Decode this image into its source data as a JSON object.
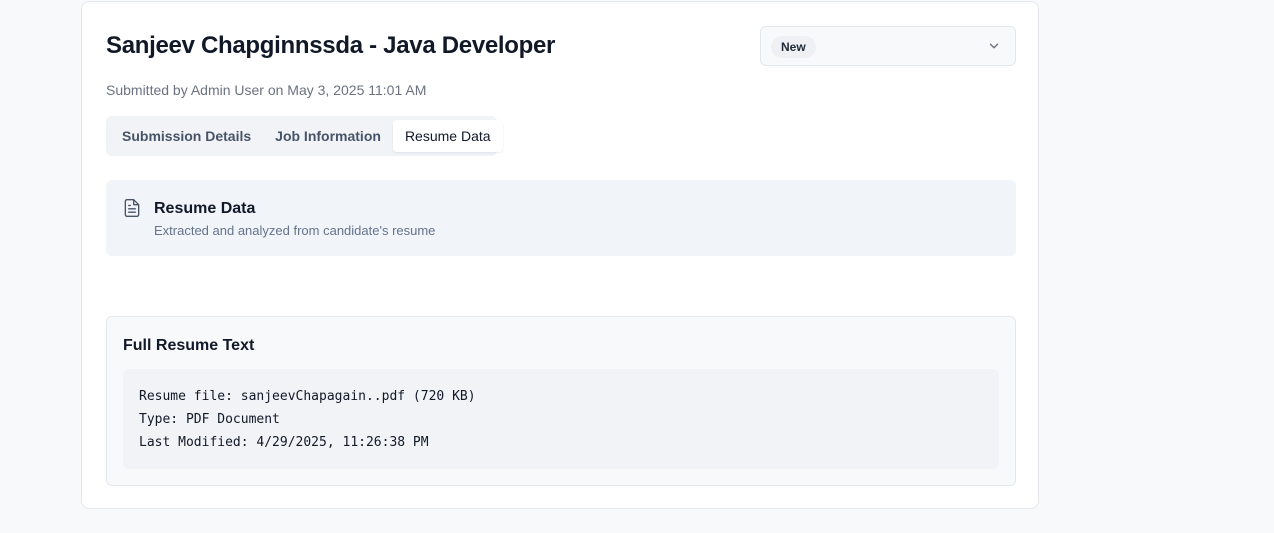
{
  "header": {
    "title": "Sanjeev Chapginnssda - Java Developer",
    "subtitle": "Submitted by Admin User on May 3, 2025 11:01 AM"
  },
  "status_select": {
    "value": "New",
    "icon": "chevron-down-icon"
  },
  "tabs": [
    {
      "label": "Submission Details",
      "active": false
    },
    {
      "label": "Job Information",
      "active": false
    },
    {
      "label": "Resume Data",
      "active": true
    }
  ],
  "info_box": {
    "icon": "document-icon",
    "title": "Resume Data",
    "description": "Extracted and analyzed from candidate's resume"
  },
  "resume": {
    "heading": "Full Resume Text",
    "lines": [
      "Resume file: sanjeevChapagain..pdf (720 KB)",
      "Type: PDF Document",
      "Last Modified: 4/29/2025, 11:26:38 PM"
    ]
  },
  "colors": {
    "page_background": "#f8f9fb",
    "card_background": "#ffffff",
    "border": "#e4e7ec",
    "info_background": "#f1f4f9",
    "muted_text": "#6b7280"
  }
}
